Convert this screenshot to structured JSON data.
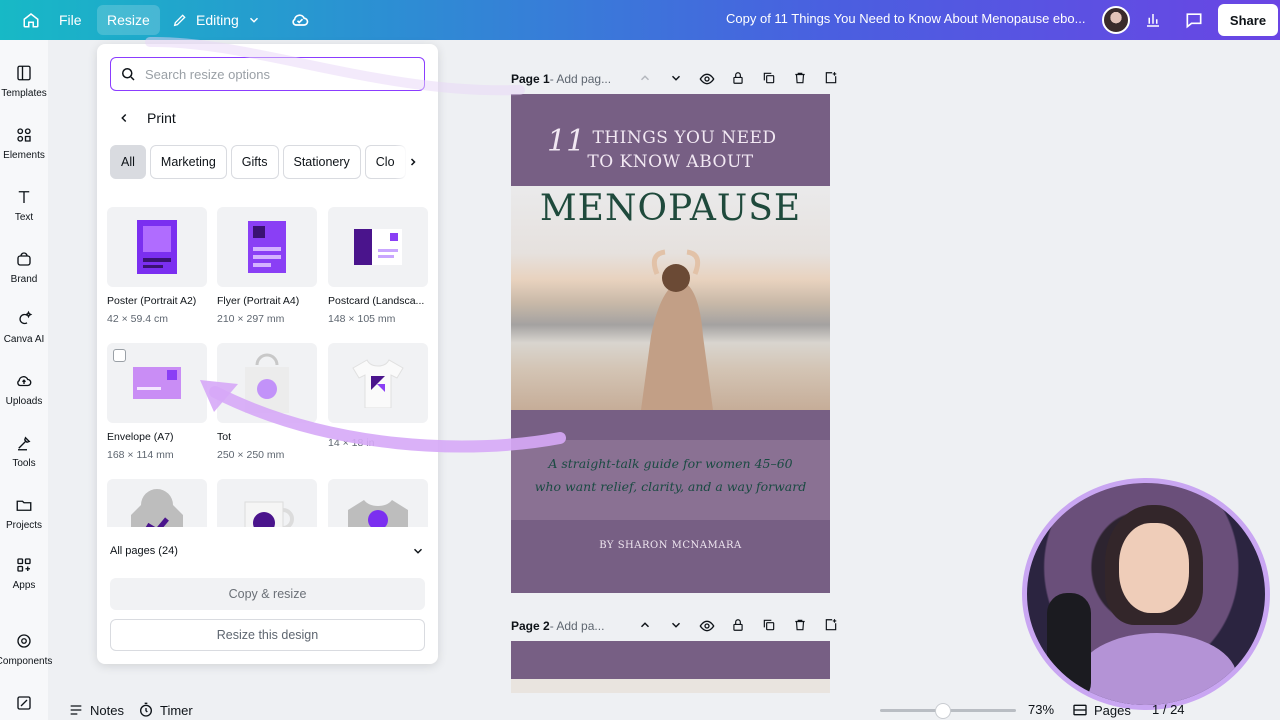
{
  "topbar": {
    "file_label": "File",
    "resize_label": "Resize",
    "editing_label": "Editing",
    "doc_title": "Copy of 11 Things You Need to Know About Menopause ebo...",
    "share_label": "Share"
  },
  "rail": {
    "items": [
      {
        "label": "Templates",
        "icon": "templates-icon"
      },
      {
        "label": "Elements",
        "icon": "elements-icon"
      },
      {
        "label": "Text",
        "icon": "text-icon"
      },
      {
        "label": "Brand",
        "icon": "brand-icon"
      },
      {
        "label": "Canva AI",
        "icon": "canva-ai-icon"
      },
      {
        "label": "Uploads",
        "icon": "uploads-icon"
      },
      {
        "label": "Tools",
        "icon": "tools-icon"
      },
      {
        "label": "Projects",
        "icon": "projects-icon"
      },
      {
        "label": "Apps",
        "icon": "apps-icon"
      },
      {
        "label": "Components",
        "icon": "components-icon"
      }
    ]
  },
  "resize_panel": {
    "search_placeholder": "Search resize options",
    "breadcrumb": "Print",
    "chips": [
      "All",
      "Marketing",
      "Gifts",
      "Stationery",
      "Clo"
    ],
    "items": [
      {
        "name": "Poster (Portrait A2)",
        "size": "42 × 59.4 cm"
      },
      {
        "name": "Flyer (Portrait A4)",
        "size": "210 × 297 mm"
      },
      {
        "name": "Postcard (Landsca...",
        "size": "148 × 105 mm"
      },
      {
        "name": "Envelope (A7)",
        "size": "168 × 114 mm"
      },
      {
        "name": "Tot",
        "size": "250 × 250 mm"
      },
      {
        "name": "",
        "size": "14 × 18 in"
      }
    ],
    "all_pages_label": "All pages (24)",
    "copy_resize_label": "Copy & resize",
    "resize_design_label": "Resize this design"
  },
  "canvas": {
    "page1_label": "Page 1",
    "page1_title": " - Add pag...",
    "page2_label": "Page 2",
    "page2_title": " - Add pa...",
    "cover": {
      "number": "11",
      "heading_line1": "THINGS YOU NEED",
      "heading_line2": "TO KNOW ABOUT",
      "big": "MENOPAUSE",
      "tagline_line1": "A straight-talk guide for women 45–60",
      "tagline_line2": "who want relief, clarity, and a way forward",
      "byline": "BY SHARON MCNAMARA"
    }
  },
  "bottombar": {
    "notes_label": "Notes",
    "timer_label": "Timer",
    "zoom_value": "73%",
    "zoom_fraction": 0.46,
    "pages_label": "Pages",
    "page_count": "1 / 24"
  },
  "colors": {
    "accent": "#8b3dff",
    "cover_purple": "#775f84",
    "cover_green": "#1f4a3c",
    "arrow": "#d6a8f7"
  }
}
